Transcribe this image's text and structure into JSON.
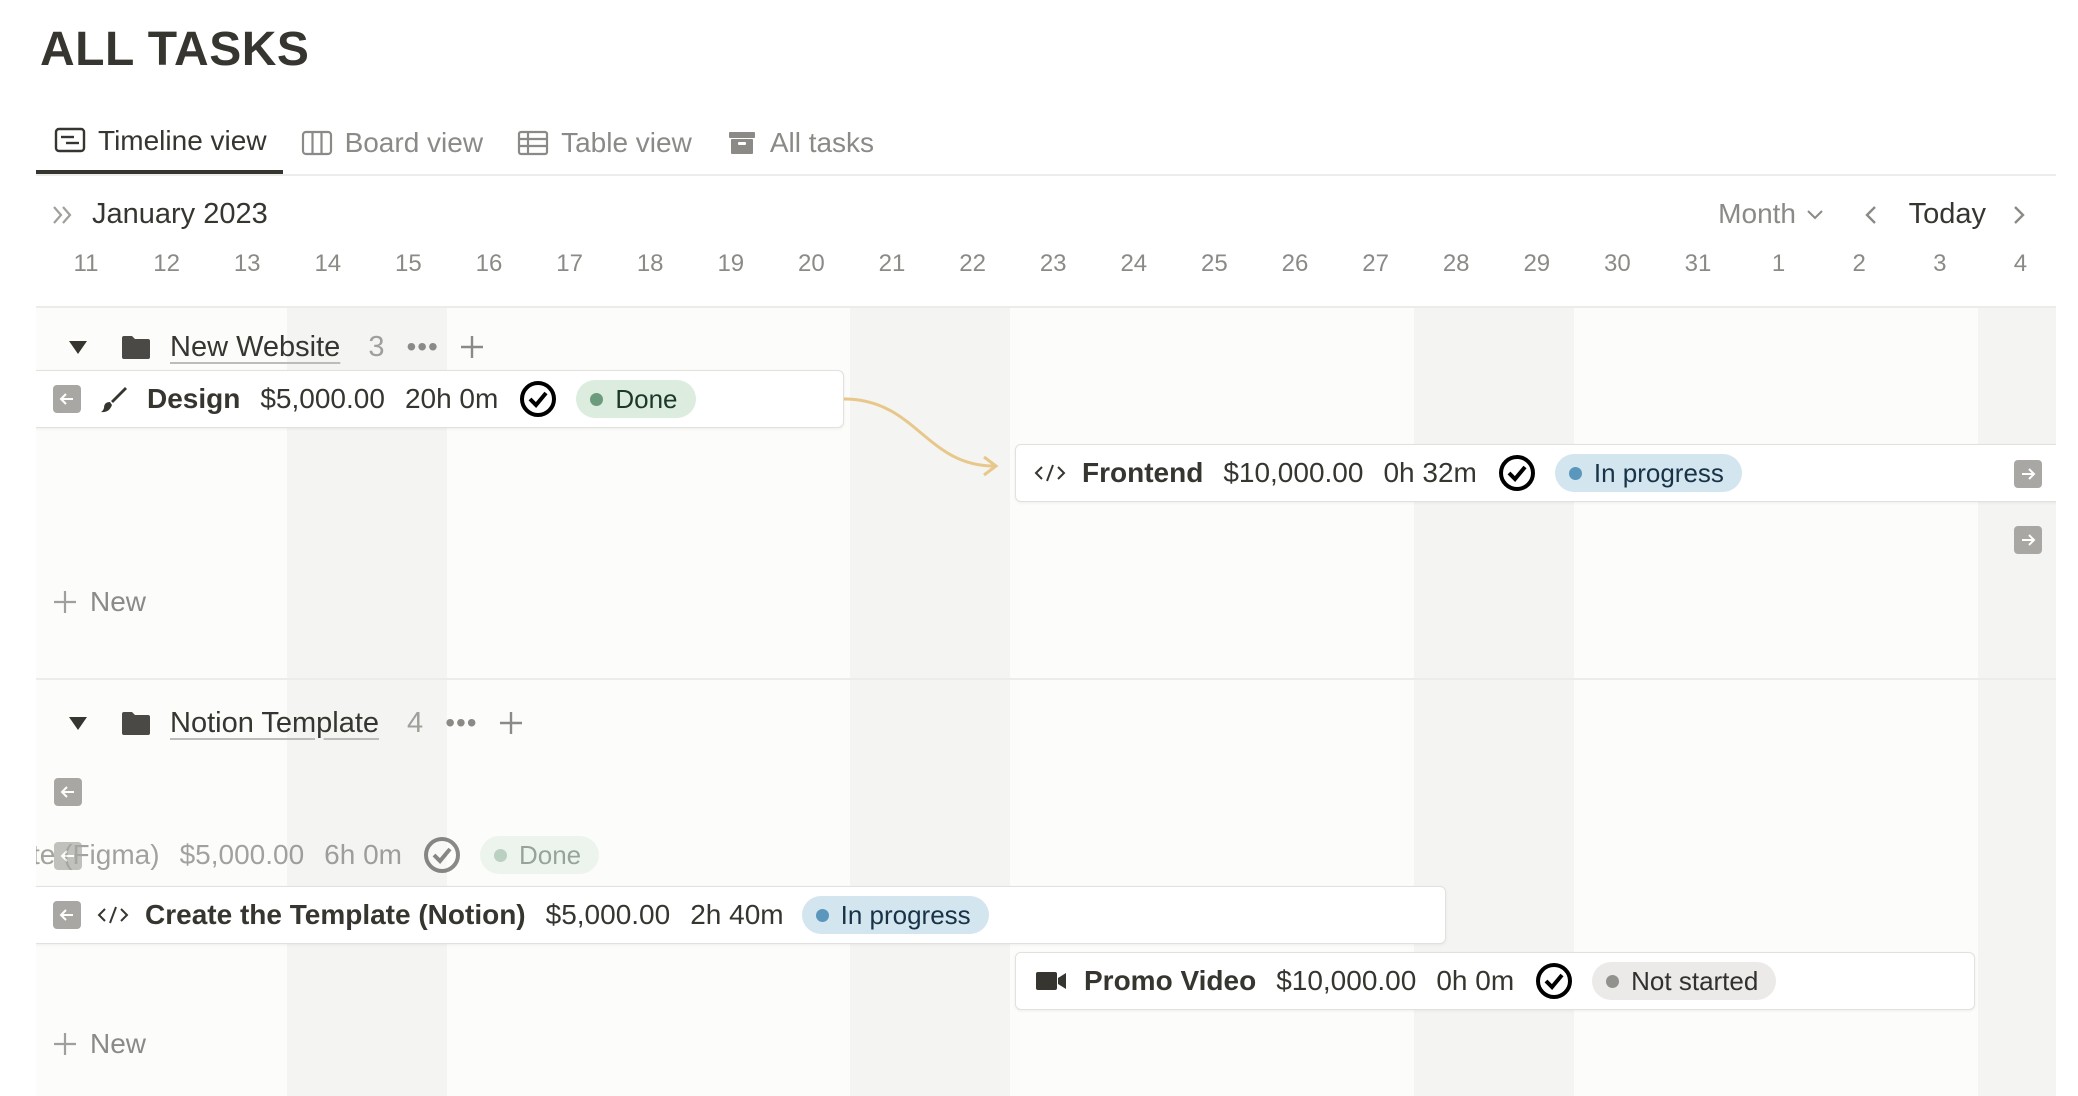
{
  "page": {
    "title": "ALL TASKS"
  },
  "tabs": [
    {
      "label": "Timeline view",
      "icon": "timeline-icon",
      "active": true
    },
    {
      "label": "Board view",
      "icon": "board-icon",
      "active": false
    },
    {
      "label": "Table view",
      "icon": "table-icon",
      "active": false
    },
    {
      "label": "All tasks",
      "icon": "archive-icon",
      "active": false
    }
  ],
  "calendar": {
    "month_label": "January 2023",
    "scale": "Month",
    "today_label": "Today",
    "days": [
      "11",
      "12",
      "13",
      "14",
      "15",
      "16",
      "17",
      "18",
      "19",
      "20",
      "21",
      "22",
      "23",
      "24",
      "25",
      "26",
      "27",
      "28",
      "29",
      "30",
      "31",
      "1",
      "2",
      "3",
      "4"
    ]
  },
  "groups": [
    {
      "name": "New Website",
      "count": "3",
      "more": "•••",
      "new_label": "New",
      "tasks": [
        {
          "name": "Design",
          "icon": "brush-icon",
          "amount": "$5,000.00",
          "hours": "20h 0m",
          "status": "Done"
        },
        {
          "name": "Frontend",
          "icon": "code-icon",
          "amount": "$10,000.00",
          "hours": "0h 32m",
          "status": "In progress"
        }
      ]
    },
    {
      "name": "Notion Template",
      "count": "4",
      "more": "•••",
      "new_label": "New",
      "tasks": [
        {
          "name": "te (Figma)",
          "icon": "",
          "amount": "$5,000.00",
          "hours": "6h 0m",
          "status": "Done"
        },
        {
          "name": "Create the Template (Notion)",
          "icon": "code-icon",
          "amount": "$5,000.00",
          "hours": "2h 40m",
          "status": "In progress"
        },
        {
          "name": "Promo Video",
          "icon": "video-icon",
          "amount": "$10,000.00",
          "hours": "0h 0m",
          "status": "Not started"
        }
      ]
    }
  ],
  "colors": {
    "done_bg": "#dcecdf",
    "progress_bg": "#d3e5ef",
    "notstarted_bg": "#ebeae8",
    "dependency_arrow": "#e8c88a"
  }
}
